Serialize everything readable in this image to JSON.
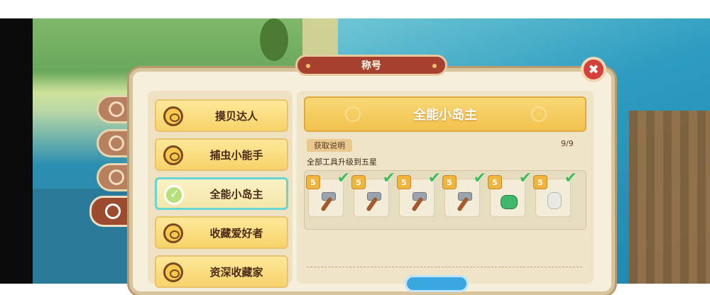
{
  "dialog": {
    "title": "称号"
  },
  "titles_list": [
    {
      "label": "摸贝达人",
      "active": false
    },
    {
      "label": "捕虫小能手",
      "active": false
    },
    {
      "label": "全能小岛主",
      "active": true
    },
    {
      "label": "收藏爱好者",
      "active": false
    },
    {
      "label": "资深收藏家",
      "active": false
    }
  ],
  "detail": {
    "title": "全能小岛主",
    "section_label": "获取说明",
    "progress": "9/9",
    "description": "全部工具升级到五星"
  },
  "tools": [
    {
      "icon": "axe-icon",
      "stars": "5",
      "completed": true
    },
    {
      "icon": "pickaxe-icon",
      "stars": "5",
      "completed": true
    },
    {
      "icon": "sickle-icon",
      "stars": "5",
      "completed": true
    },
    {
      "icon": "hatchet-icon",
      "stars": "5",
      "completed": true
    },
    {
      "icon": "watering-can-icon",
      "stars": "5",
      "completed": true
    },
    {
      "icon": "glove-icon",
      "stars": "5",
      "completed": true
    }
  ],
  "side_tabs": [
    "gear-icon",
    "book-icon",
    "chef-hat-icon",
    "title-badge-icon"
  ],
  "colors": {
    "accent_gold": "#f2c24e",
    "title_red": "#a6402f",
    "active_outline": "#67d6d2",
    "check_green": "#3fbf5a"
  }
}
